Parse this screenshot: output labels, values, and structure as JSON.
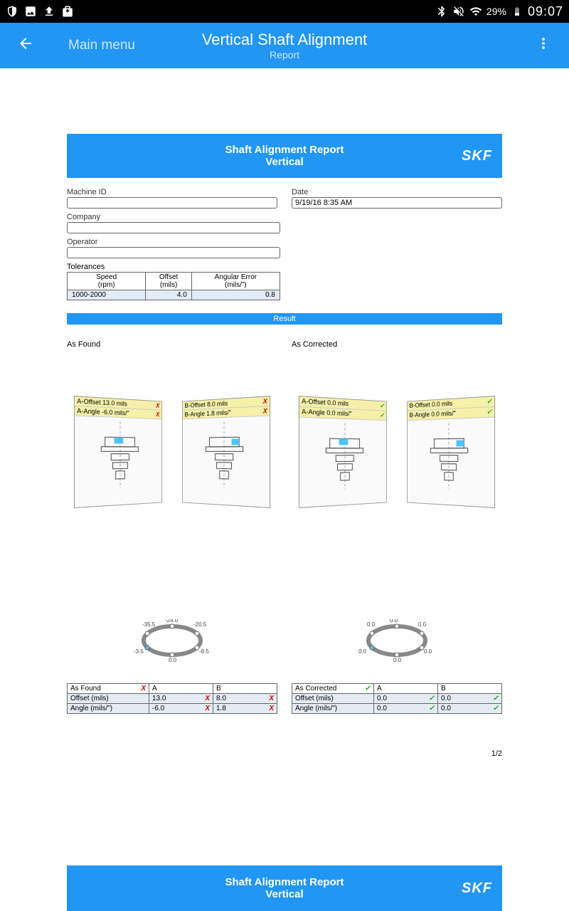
{
  "status": {
    "battery": "29%",
    "time": "09:07"
  },
  "header": {
    "main_menu": "Main menu",
    "title": "Vertical Shaft Alignment",
    "subtitle": "Report"
  },
  "report": {
    "banner_line1": "Shaft Alignment Report",
    "banner_line2": "Vertical",
    "brand": "SKF",
    "fields": {
      "machine_id_label": "Machine ID",
      "machine_id_value": "",
      "date_label": "Date",
      "date_value": "9/19/16 8:35 AM",
      "company_label": "Company",
      "company_value": "",
      "operator_label": "Operator",
      "operator_value": ""
    },
    "tolerances": {
      "label": "Tolerances",
      "headers": {
        "speed": "Speed",
        "speed_unit": "(rpm)",
        "offset": "Offset",
        "offset_unit": "(mils)",
        "angular": "Angular Error",
        "angular_unit": "(mils/\")"
      },
      "row": {
        "speed": "1000-2000",
        "offset": "4.0",
        "angular": "0.8"
      }
    },
    "result_label": "Result",
    "columns": {
      "found_label": "As Found",
      "corrected_label": "As Corrected"
    },
    "found_panel_a": {
      "line1": "A-Offset 13.0 mils",
      "line2": "A-Angle -6.0 mils/\""
    },
    "found_panel_b": {
      "line1": "B-Offset 8.0 mils",
      "line2": "B-Angle 1.8 mils/\""
    },
    "corrected_panel_a": {
      "line1": "A-Offset 0.0 mils",
      "line2": "A-Angle 0.0 mils/\""
    },
    "corrected_panel_b": {
      "line1": "B-Offset 0.0 mils",
      "line2": "B-Angle 0.0 mils/\""
    },
    "found_ring": [
      "-35.5",
      "-24.0",
      "-20.5",
      "-8.5",
      "0.0",
      "-3.5"
    ],
    "corrected_ring": [
      "0.0",
      "0.0",
      "0.0",
      "0.0",
      "0.0",
      "0.0"
    ],
    "table_found": {
      "title": "As Found",
      "col_a": "A",
      "col_b": "B",
      "offset_label": "Offset (mils)",
      "offset_a": "13.0",
      "offset_b": "8.0",
      "angle_label": "Angle (mils/\")",
      "angle_a": "-6.0",
      "angle_b": "1.8"
    },
    "table_corrected": {
      "title": "As Corrected",
      "col_a": "A",
      "col_b": "B",
      "offset_label": "Offset (mils)",
      "offset_a": "0.0",
      "offset_b": "0.0",
      "angle_label": "Angle (mils/\")",
      "angle_a": "0.0",
      "angle_b": "0.0"
    },
    "page_num": "1/2"
  }
}
